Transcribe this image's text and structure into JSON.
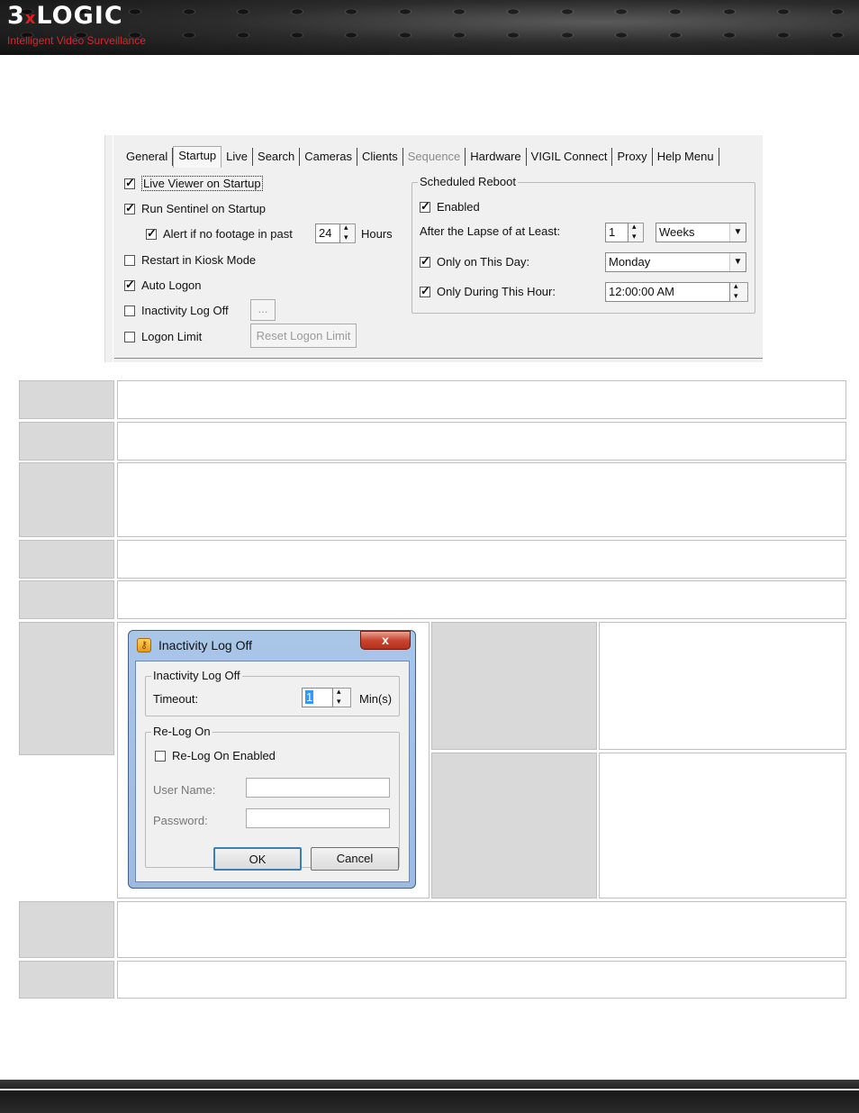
{
  "header": {
    "logo_main": "3",
    "logo_x": "x",
    "logo_rest": "LOGIC",
    "tagline": "Intelligent Video Surveillance"
  },
  "panel": {
    "tabs": [
      "General",
      "Startup",
      "Live",
      "Search",
      "Cameras",
      "Clients",
      "Sequence",
      "Hardware",
      "VIGIL Connect",
      "Proxy",
      "Help Menu"
    ],
    "active_tab": "Startup",
    "disabled_tab": "Sequence",
    "options": {
      "live_viewer": {
        "label": "Live Viewer on Startup",
        "checked": true
      },
      "run_sentinel": {
        "label": "Run Sentinel on Startup",
        "checked": true
      },
      "alert_footage": {
        "label": "Alert if no footage in past",
        "checked": true,
        "value": "24",
        "unit": "Hours"
      },
      "kiosk": {
        "label": "Restart in Kiosk Mode",
        "checked": false
      },
      "auto_logon": {
        "label": "Auto Logon",
        "checked": true
      },
      "inactivity": {
        "label": "Inactivity Log Off",
        "checked": false,
        "button": "..."
      },
      "logon_limit": {
        "label": "Logon Limit",
        "checked": false,
        "button": "Reset Logon Limit"
      }
    },
    "reboot": {
      "legend": "Scheduled Reboot",
      "enabled_label": "Enabled",
      "lapse_label": "After the Lapse of at Least:",
      "lapse_value": "1",
      "lapse_unit": "Weeks",
      "day_label": "Only on This Day:",
      "day_value": "Monday",
      "hour_label": "Only During This Hour:",
      "hour_value": "12:00:00 AM"
    }
  },
  "dialog": {
    "title": "Inactivity Log Off",
    "close": "x",
    "group1_legend": "Inactivity Log Off",
    "timeout_label": "Timeout:",
    "timeout_value": "1",
    "timeout_unit": "Min(s)",
    "group2_legend": "Re-Log On",
    "relog_label": "Re-Log On Enabled",
    "username_label": "User Name:",
    "password_label": "Password:",
    "ok": "OK",
    "cancel": "Cancel"
  }
}
